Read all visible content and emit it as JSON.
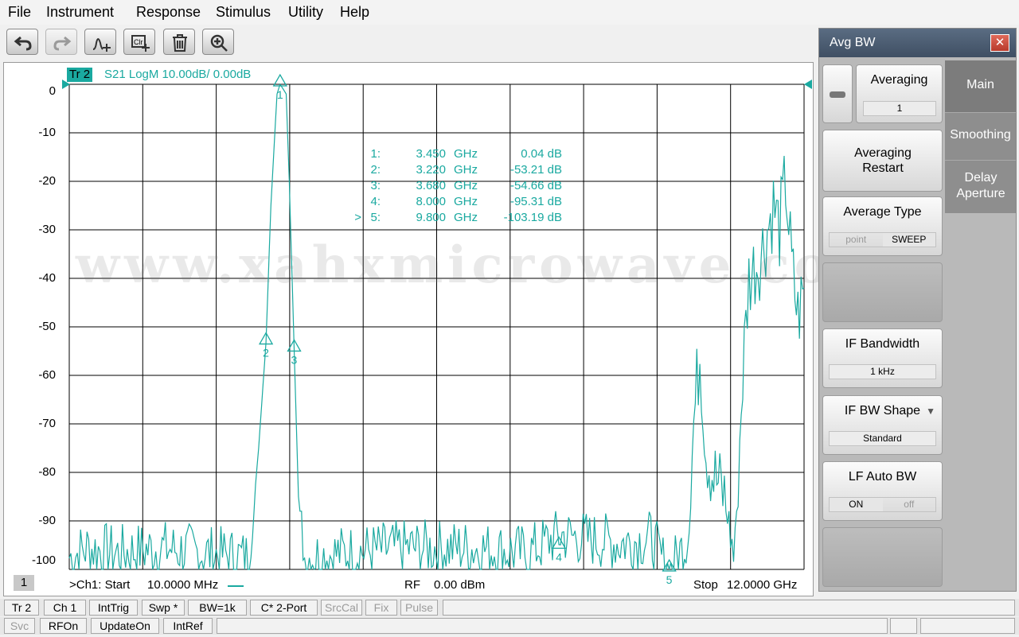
{
  "menu": [
    "File",
    "Instrument",
    "Response",
    "Stimulus",
    "Utility",
    "Help"
  ],
  "toolbar": [
    {
      "name": "undo-icon"
    },
    {
      "name": "redo-icon"
    },
    {
      "name": "add-marker-icon"
    },
    {
      "name": "clear-marker-icon"
    },
    {
      "name": "delete-icon"
    },
    {
      "name": "zoom-icon"
    }
  ],
  "trace": {
    "tr_label": "Tr 2",
    "title": "S21 LogM 10.00dB/  0.00dB",
    "color": "#1aa9a0"
  },
  "yticks": [
    "0",
    "-10",
    "-20",
    "-30",
    "-40",
    "-50",
    "-60",
    "-70",
    "-80",
    "-90",
    "-100"
  ],
  "markers": [
    {
      "prefix": "",
      "num": "1:",
      "freq": "3.450",
      "unit": "GHz",
      "val": "0.04 dB"
    },
    {
      "prefix": "",
      "num": "2:",
      "freq": "3.220",
      "unit": "GHz",
      "val": "-53.21 dB"
    },
    {
      "prefix": "",
      "num": "3:",
      "freq": "3.680",
      "unit": "GHz",
      "val": "-54.66 dB"
    },
    {
      "prefix": "",
      "num": "4:",
      "freq": "8.000",
      "unit": "GHz",
      "val": "-95.31 dB"
    },
    {
      "prefix": ">",
      "num": "5:",
      "freq": "9.800",
      "unit": "GHz",
      "val": "-103.19 dB"
    }
  ],
  "marker_labels": [
    "1",
    "2",
    "3",
    "4",
    "5"
  ],
  "footer": {
    "channel_badge": "1",
    "start_label": ">Ch1:  Start",
    "start_value": "10.0000 MHz",
    "rf_label": "RF",
    "rf_value": "0.00 dBm",
    "stop_label": "Stop",
    "stop_value": "12.0000 GHz"
  },
  "watermark": "www.xahxmicrowave.com",
  "panel": {
    "title": "Avg BW",
    "tabs": [
      "Main",
      "Smoothing",
      "Delay Aperture"
    ],
    "averaging_label": "Averaging",
    "averaging_value": "1",
    "averaging_restart": "Averaging Restart",
    "average_type": "Average Type",
    "average_type_options": [
      "point",
      "SWEEP"
    ],
    "if_bandwidth": "IF Bandwidth",
    "if_bandwidth_value": "1 kHz",
    "if_bw_shape": "IF BW Shape",
    "if_bw_shape_value": "Standard",
    "lf_auto_bw": "LF Auto BW",
    "lf_auto_bw_options": [
      "ON",
      "off"
    ]
  },
  "status_row1": [
    "Tr 2",
    "Ch 1",
    "IntTrig",
    "Swp *",
    "BW=1k",
    "C* 2-Port",
    "SrcCal",
    "Fix",
    "Pulse"
  ],
  "status_row2": [
    "Svc",
    "RFOn",
    "UpdateOn",
    "IntRef"
  ],
  "chart_data": {
    "type": "line",
    "title": "S21 LogM 10.00dB/  0.00dB",
    "xlabel": "",
    "ylabel": "",
    "xlim_ghz": [
      0.01,
      12.0
    ],
    "ylim_db": [
      -100,
      0
    ],
    "grid": true,
    "series": [
      {
        "x_ghz": [
          0.01,
          0.3,
          0.8,
          1.5,
          2.2,
          2.95,
          3.0,
          3.1,
          3.22,
          3.3,
          3.4,
          3.45,
          3.55,
          3.6,
          3.68,
          3.75,
          3.85,
          4.5,
          5.5,
          6.5,
          7.5,
          8.0,
          9.0,
          9.5,
          9.8,
          10.1,
          10.2,
          10.3,
          10.4,
          10.5,
          10.7,
          10.85,
          11.0,
          11.1,
          11.3,
          11.5,
          11.6,
          11.7,
          11.8,
          11.9,
          12.0
        ],
        "y_db": [
          -100,
          -98,
          -99,
          -98,
          -99,
          -100,
          -90,
          -75,
          -53.21,
          -25,
          -2,
          0.04,
          -2,
          -20,
          -54.66,
          -85,
          -100,
          -99,
          -98,
          -98,
          -99,
          -95.31,
          -97,
          -96,
          -103.19,
          -96,
          -70,
          -55,
          -75,
          -80,
          -85,
          -100,
          -60,
          -40,
          -35,
          -25,
          -30,
          -20,
          -38,
          -48,
          -42
        ]
      }
    ],
    "markers": [
      {
        "id": 1,
        "x_ghz": 3.45,
        "y_db": 0.04
      },
      {
        "id": 2,
        "x_ghz": 3.22,
        "y_db": -53.21
      },
      {
        "id": 3,
        "x_ghz": 3.68,
        "y_db": -54.66
      },
      {
        "id": 4,
        "x_ghz": 8.0,
        "y_db": -95.31
      },
      {
        "id": 5,
        "x_ghz": 9.8,
        "y_db": -103.19
      }
    ]
  }
}
